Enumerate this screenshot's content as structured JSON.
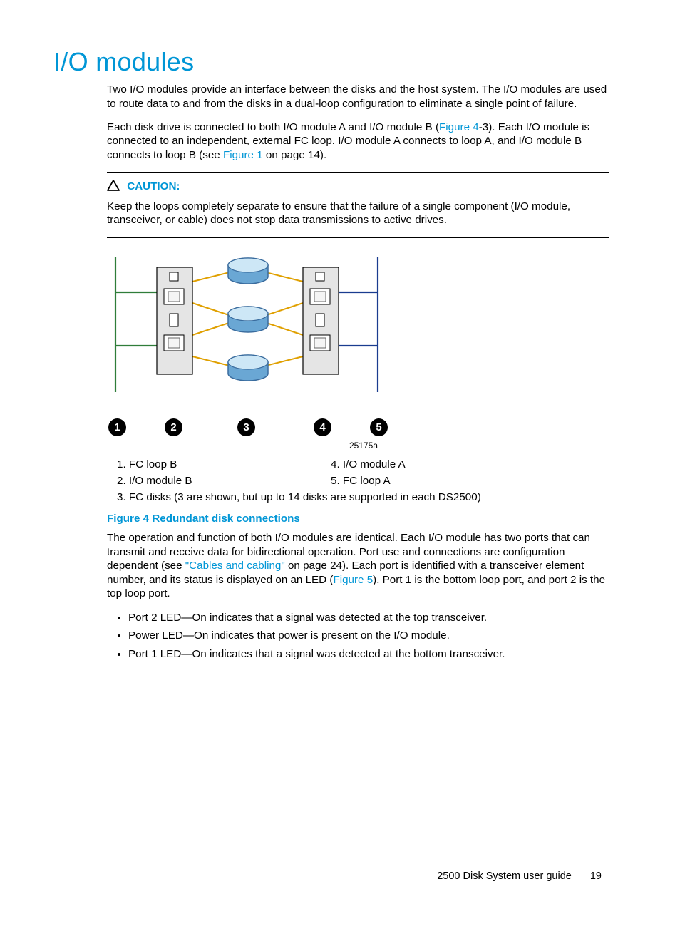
{
  "title": "I/O modules",
  "para1": "Two I/O modules provide an interface between the disks and the host system. The I/O modules are used to route data to and from the disks in a dual-loop configuration to eliminate a single point of failure.",
  "para2a": "Each disk drive is connected to both I/O module A and I/O module B (",
  "para2_link": "Figure 4",
  "para2b": "-3). Each I/O module is connected to an independent, external FC loop. I/O module A connects to loop A, and I/O module B connects to loop B (see ",
  "para2_link2": "Figure 1",
  "para2c": " on page 14).",
  "caution_label": "CAUTION:",
  "caution_text": "Keep the loops completely separate to ensure that the failure of a single component (I/O module, transceiver, or cable) does not stop data transmissions to active drives.",
  "figure_id": "25175a",
  "callouts": [
    "1",
    "2",
    "3",
    "4",
    "5"
  ],
  "legend": {
    "l1": "1.  FC loop B",
    "l2": "2.  I/O module B",
    "l3": "3.  FC disks (3 are shown, but up to 14 disks are supported in each DS2500)",
    "r1": "4.  I/O module A",
    "r2": "5.  FC loop A"
  },
  "figure_caption": "Figure 4 Redundant disk connections",
  "para3a": "The operation and function of both I/O modules are identical. Each I/O module has two ports that can transmit and receive data for bidirectional operation. Port use and connections are configuration dependent (see ",
  "para3_link1": "\"Cables and cabling\"",
  "para3b": " on page 24). Each port is identified with a transceiver element number, and its status is displayed on an LED (",
  "para3_link2": "Figure 5",
  "para3c": "). Port 1 is the bottom loop port, and port 2 is the top loop port.",
  "bullets": [
    "Port 2 LED—On indicates that a signal was detected at the top transceiver.",
    "Power LED—On indicates that power is present on the I/O module.",
    "Port 1 LED—On indicates that a signal was detected at the bottom transceiver."
  ],
  "footer_doc": "2500 Disk System user guide",
  "footer_page": "19"
}
